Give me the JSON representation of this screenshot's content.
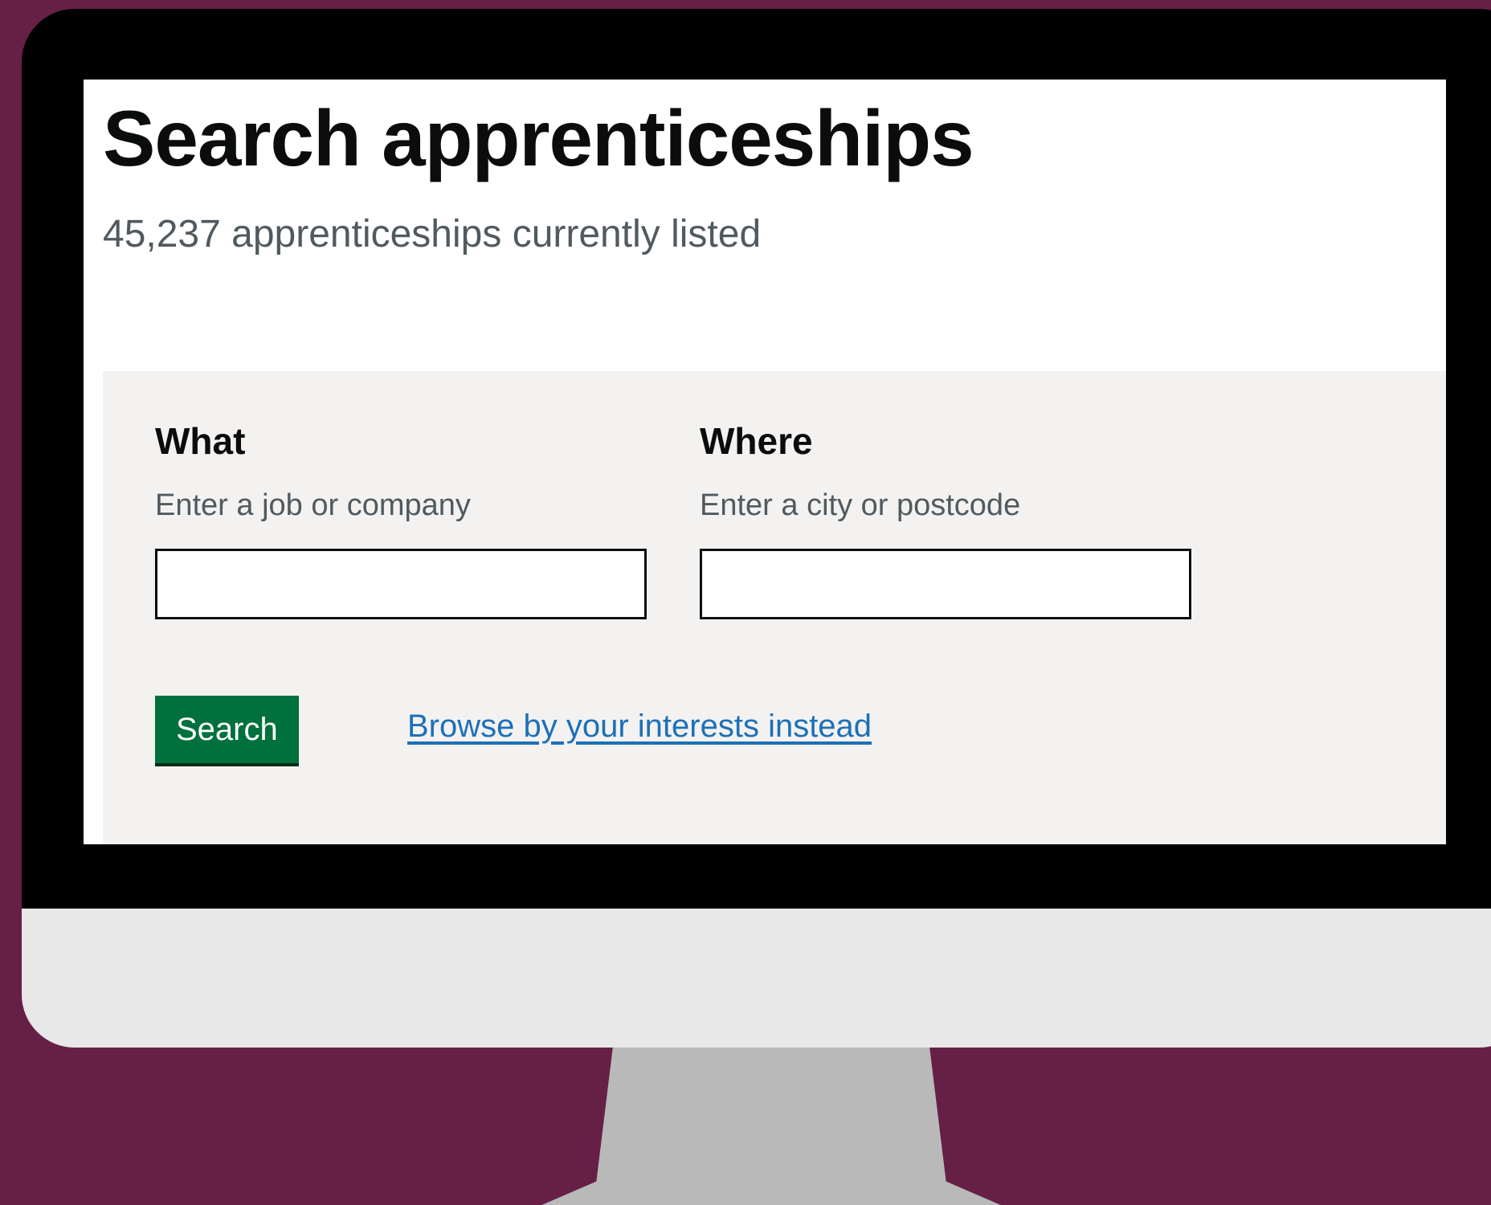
{
  "page": {
    "title": "Search apprenticeships",
    "subtitle": "45,237 apprenticeships currently listed"
  },
  "search": {
    "what": {
      "label": "What",
      "hint": "Enter a job or company",
      "value": ""
    },
    "where": {
      "label": "Where",
      "hint": "Enter a city or postcode",
      "value": ""
    },
    "button_label": "Search",
    "browse_link": "Browse by your interests instead"
  },
  "colors": {
    "background": "#662046",
    "button": "#00703c",
    "link": "#1d70b8",
    "panel": "#f3f2f1"
  }
}
